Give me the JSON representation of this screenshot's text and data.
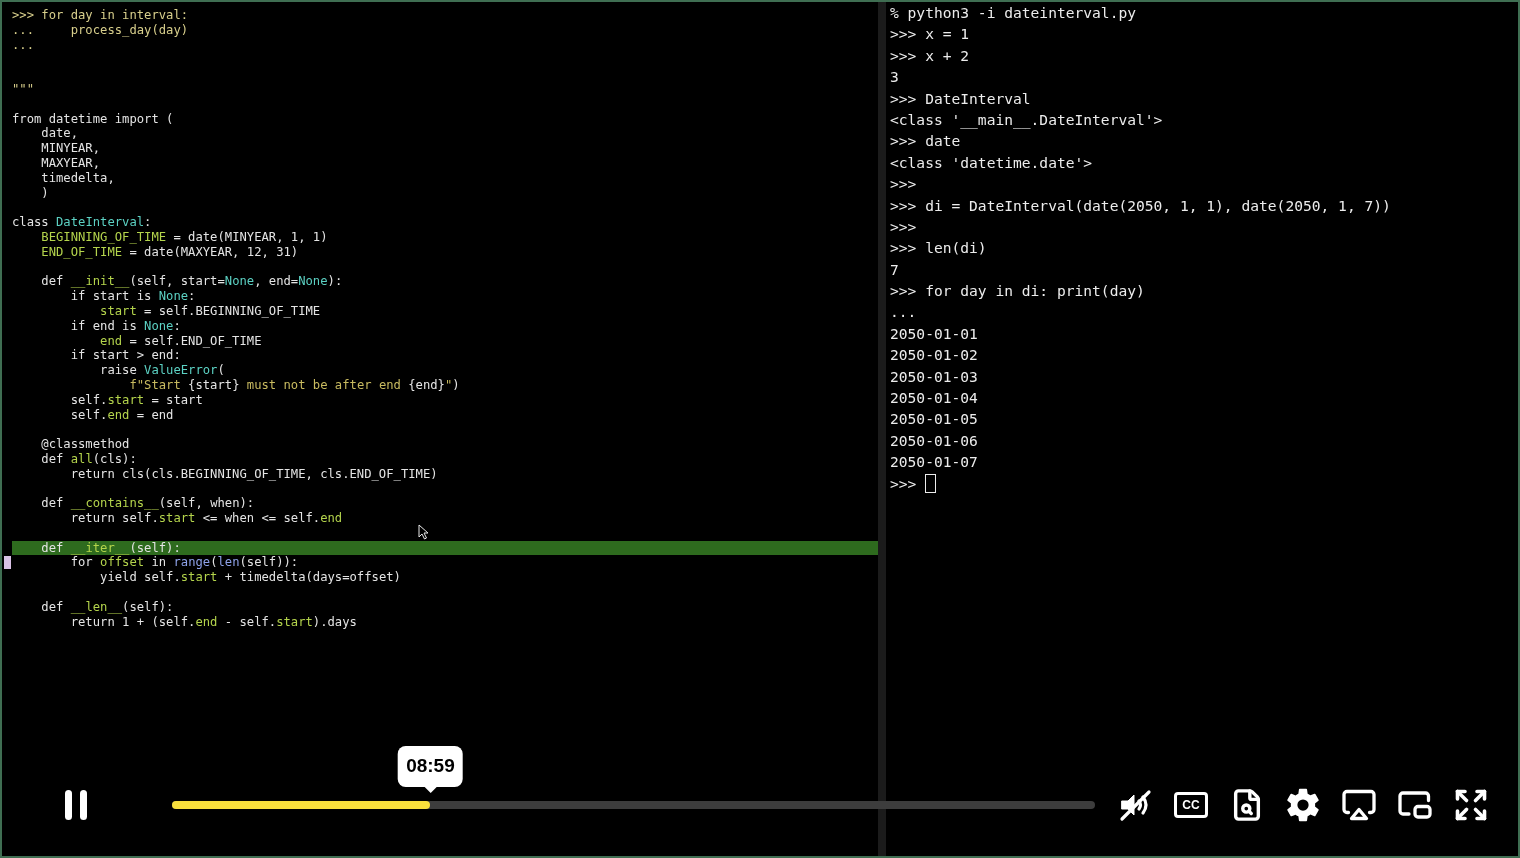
{
  "video": {
    "editor": {
      "lines": [
        {
          "kind": "code",
          "segments": [
            {
              "text": ">>> for day in interval:",
              "kind": "prompt"
            }
          ]
        },
        {
          "kind": "code",
          "segments": [
            {
              "text": "...     process_day(day)",
              "kind": "prompt"
            }
          ]
        },
        {
          "kind": "code",
          "segments": [
            {
              "text": "...",
              "kind": "prompt"
            }
          ]
        },
        {
          "kind": "blank"
        },
        {
          "kind": "blank"
        },
        {
          "kind": "code",
          "segments": [
            {
              "text": "\"\"\"",
              "kind": "prompt"
            }
          ]
        },
        {
          "kind": "blank"
        },
        {
          "kind": "code",
          "segments": [
            {
              "text": "from datetime import (",
              "kind": "text"
            }
          ]
        },
        {
          "kind": "code",
          "segments": [
            {
              "text": "    date,",
              "kind": "text"
            }
          ]
        },
        {
          "kind": "code",
          "segments": [
            {
              "text": "    MINYEAR,",
              "kind": "text"
            }
          ]
        },
        {
          "kind": "code",
          "segments": [
            {
              "text": "    MAXYEAR,",
              "kind": "text"
            }
          ]
        },
        {
          "kind": "code",
          "segments": [
            {
              "text": "    timedelta,",
              "kind": "text"
            }
          ]
        },
        {
          "kind": "code",
          "segments": [
            {
              "text": "    )",
              "kind": "text"
            }
          ]
        },
        {
          "kind": "blank"
        },
        {
          "kind": "code",
          "segments": [
            {
              "text": "class ",
              "kind": "text"
            },
            {
              "text": "DateInterval",
              "kind": "constant"
            },
            {
              "text": ":",
              "kind": "text"
            }
          ]
        },
        {
          "kind": "code",
          "segments": [
            {
              "text": "    BEGINNING_OF_TIME",
              "kind": "identifier"
            },
            {
              "text": " = date(MINYEAR, 1, 1)",
              "kind": "text"
            }
          ]
        },
        {
          "kind": "code",
          "segments": [
            {
              "text": "    END_OF_TIME",
              "kind": "identifier"
            },
            {
              "text": " = date(MAXYEAR, 12, 31)",
              "kind": "text"
            }
          ]
        },
        {
          "kind": "blank"
        },
        {
          "kind": "code",
          "segments": [
            {
              "text": "    def ",
              "kind": "text"
            },
            {
              "text": "__init__",
              "kind": "identifier"
            },
            {
              "text": "(self, start=",
              "kind": "text"
            },
            {
              "text": "None",
              "kind": "constant"
            },
            {
              "text": ", end=",
              "kind": "text"
            },
            {
              "text": "None",
              "kind": "constant"
            },
            {
              "text": "):",
              "kind": "text"
            }
          ]
        },
        {
          "kind": "code",
          "segments": [
            {
              "text": "        if start is ",
              "kind": "text"
            },
            {
              "text": "None",
              "kind": "constant"
            },
            {
              "text": ":",
              "kind": "text"
            }
          ]
        },
        {
          "kind": "code",
          "segments": [
            {
              "text": "            start",
              "kind": "identifier"
            },
            {
              "text": " = self.BEGINNING_OF_TIME",
              "kind": "text"
            }
          ]
        },
        {
          "kind": "code",
          "segments": [
            {
              "text": "        if end is ",
              "kind": "text"
            },
            {
              "text": "None",
              "kind": "constant"
            },
            {
              "text": ":",
              "kind": "text"
            }
          ]
        },
        {
          "kind": "code",
          "segments": [
            {
              "text": "            end",
              "kind": "identifier"
            },
            {
              "text": " = self.END_OF_TIME",
              "kind": "text"
            }
          ]
        },
        {
          "kind": "code",
          "segments": [
            {
              "text": "        if start > end:",
              "kind": "text"
            }
          ]
        },
        {
          "kind": "code",
          "segments": [
            {
              "text": "            raise ",
              "kind": "text"
            },
            {
              "text": "ValueError",
              "kind": "constant"
            },
            {
              "text": "(",
              "kind": "text"
            }
          ]
        },
        {
          "kind": "code",
          "segments": [
            {
              "text": "                f\"Start ",
              "kind": "string"
            },
            {
              "text": "{start}",
              "kind": "text"
            },
            {
              "text": " must not be after end ",
              "kind": "string"
            },
            {
              "text": "{end}",
              "kind": "text"
            },
            {
              "text": "\"",
              "kind": "string"
            },
            {
              "text": ")",
              "kind": "text"
            }
          ]
        },
        {
          "kind": "code",
          "segments": [
            {
              "text": "        self.",
              "kind": "text"
            },
            {
              "text": "start",
              "kind": "identifier"
            },
            {
              "text": " = start",
              "kind": "text"
            }
          ]
        },
        {
          "kind": "code",
          "segments": [
            {
              "text": "        self.",
              "kind": "text"
            },
            {
              "text": "end",
              "kind": "identifier"
            },
            {
              "text": " = end",
              "kind": "text"
            }
          ]
        },
        {
          "kind": "blank"
        },
        {
          "kind": "code",
          "segments": [
            {
              "text": "    @classmethod",
              "kind": "text"
            }
          ]
        },
        {
          "kind": "code",
          "segments": [
            {
              "text": "    def ",
              "kind": "text"
            },
            {
              "text": "all",
              "kind": "identifier"
            },
            {
              "text": "(cls):",
              "kind": "text"
            }
          ]
        },
        {
          "kind": "code",
          "segments": [
            {
              "text": "        return cls(cls.BEGINNING_OF_TIME, cls.END_OF_TIME)",
              "kind": "text"
            }
          ]
        },
        {
          "kind": "blank"
        },
        {
          "kind": "code",
          "segments": [
            {
              "text": "    def ",
              "kind": "text"
            },
            {
              "text": "__contains__",
              "kind": "identifier"
            },
            {
              "text": "(self, when):",
              "kind": "text"
            }
          ]
        },
        {
          "kind": "code",
          "segments": [
            {
              "text": "        return self.",
              "kind": "text"
            },
            {
              "text": "start",
              "kind": "identifier"
            },
            {
              "text": " <= when <= self.",
              "kind": "text"
            },
            {
              "text": "end",
              "kind": "identifier"
            }
          ]
        },
        {
          "kind": "blank"
        },
        {
          "kind": "highlighted",
          "segments": [
            {
              "text": "    def ",
              "kind": "text"
            },
            {
              "text": "__iter__",
              "kind": "identifier"
            },
            {
              "text": "(self):",
              "kind": "text"
            }
          ]
        },
        {
          "kind": "code",
          "segments": [
            {
              "text": "        for ",
              "kind": "text"
            },
            {
              "text": "offset",
              "kind": "identifier"
            },
            {
              "text": " in ",
              "kind": "text"
            },
            {
              "text": "range",
              "kind": "builtin"
            },
            {
              "text": "(",
              "kind": "text"
            },
            {
              "text": "len",
              "kind": "builtin"
            },
            {
              "text": "(self)):",
              "kind": "text"
            }
          ]
        },
        {
          "kind": "code",
          "segments": [
            {
              "text": "            yield self.",
              "kind": "text"
            },
            {
              "text": "start",
              "kind": "identifier"
            },
            {
              "text": " + timedelta(days=offset)",
              "kind": "text"
            }
          ]
        },
        {
          "kind": "blank"
        },
        {
          "kind": "code",
          "segments": [
            {
              "text": "    def ",
              "kind": "text"
            },
            {
              "text": "__len__",
              "kind": "identifier"
            },
            {
              "text": "(self):",
              "kind": "text"
            }
          ]
        },
        {
          "kind": "code",
          "segments": [
            {
              "text": "        return 1 + (self.",
              "kind": "text"
            },
            {
              "text": "end",
              "kind": "identifier"
            },
            {
              "text": " - self.",
              "kind": "text"
            },
            {
              "text": "start",
              "kind": "identifier"
            },
            {
              "text": ").days",
              "kind": "text"
            }
          ]
        }
      ]
    },
    "terminal": {
      "lines": [
        "% python3 -i dateinterval.py",
        ">>> x = 1",
        ">>> x + 2",
        "3",
        ">>> DateInterval",
        "<class '__main__.DateInterval'>",
        ">>> date",
        "<class 'datetime.date'>",
        ">>>",
        ">>> di = DateInterval(date(2050, 1, 1), date(2050, 1, 7))",
        ">>>",
        ">>> len(di)",
        "7",
        ">>> for day in di: print(day)",
        "...",
        "2050-01-01",
        "2050-01-02",
        "2050-01-03",
        "2050-01-04",
        "2050-01-05",
        "2050-01-06",
        "2050-01-07",
        ">>>"
      ],
      "cursor": true
    }
  },
  "controls": {
    "playing": true,
    "progress": {
      "level": 0.28
    },
    "time_tooltip": "08:59",
    "captions_label": "CC"
  }
}
